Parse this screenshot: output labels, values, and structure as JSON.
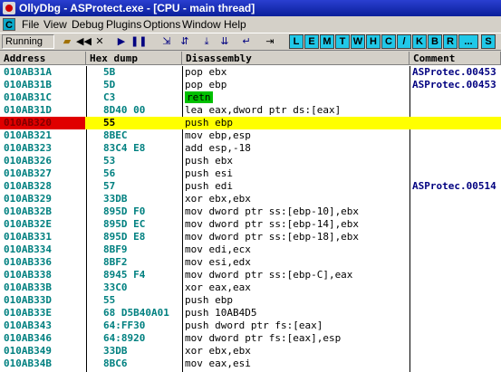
{
  "window": {
    "title": "OllyDbg - ASProtect.exe - [CPU - main thread]"
  },
  "menu": {
    "cpu_icon": "C",
    "items": [
      "File",
      "View",
      "Debug",
      "Plugins",
      "Options",
      "Window",
      "Help"
    ]
  },
  "toolbar": {
    "status": "Running",
    "buttons": [
      "open-icon",
      "rewind-icon",
      "close-icon",
      "run-icon",
      "pause-icon",
      "step-into-icon",
      "step-over-icon",
      "trace-into-icon",
      "trace-over-icon",
      "execute-till-return-icon",
      "goto-icon"
    ],
    "letters": [
      "L",
      "E",
      "M",
      "T",
      "W",
      "H",
      "C",
      "/",
      "K",
      "B",
      "R",
      "...",
      "S"
    ]
  },
  "columns": [
    "Address",
    "Hex dump",
    "Disassembly",
    "Comment"
  ],
  "rows": [
    {
      "addr": "010AB31A",
      "hex": "5B",
      "dis": "pop ebx",
      "comment": "ASProtec.00453"
    },
    {
      "addr": "010AB31B",
      "hex": "5D",
      "dis": "pop ebp",
      "comment": "ASProtec.00453"
    },
    {
      "addr": "010AB31C",
      "hex": "C3",
      "dis": "retn",
      "comment": "",
      "retn": true
    },
    {
      "addr": "010AB31D",
      "hex": "8D40 00",
      "dis": "lea eax,dword ptr ds:[eax]",
      "comment": ""
    },
    {
      "addr": "010AB320",
      "hex": "55",
      "dis": "push ebp",
      "comment": "",
      "highlight": true
    },
    {
      "addr": "010AB321",
      "hex": "8BEC",
      "dis": "mov ebp,esp",
      "comment": ""
    },
    {
      "addr": "010AB323",
      "hex": "83C4 E8",
      "dis": "add esp,-18",
      "comment": ""
    },
    {
      "addr": "010AB326",
      "hex": "53",
      "dis": "push ebx",
      "comment": ""
    },
    {
      "addr": "010AB327",
      "hex": "56",
      "dis": "push esi",
      "comment": ""
    },
    {
      "addr": "010AB328",
      "hex": "57",
      "dis": "push edi",
      "comment": "ASProtec.00514"
    },
    {
      "addr": "010AB329",
      "hex": "33DB",
      "dis": "xor ebx,ebx",
      "comment": ""
    },
    {
      "addr": "010AB32B",
      "hex": "895D F0",
      "dis": "mov dword ptr ss:[ebp-10],ebx",
      "comment": ""
    },
    {
      "addr": "010AB32E",
      "hex": "895D EC",
      "dis": "mov dword ptr ss:[ebp-14],ebx",
      "comment": ""
    },
    {
      "addr": "010AB331",
      "hex": "895D E8",
      "dis": "mov dword ptr ss:[ebp-18],ebx",
      "comment": ""
    },
    {
      "addr": "010AB334",
      "hex": "8BF9",
      "dis": "mov edi,ecx",
      "comment": ""
    },
    {
      "addr": "010AB336",
      "hex": "8BF2",
      "dis": "mov esi,edx",
      "comment": ""
    },
    {
      "addr": "010AB338",
      "hex": "8945 F4",
      "dis": "mov dword ptr ss:[ebp-C],eax",
      "comment": ""
    },
    {
      "addr": "010AB33B",
      "hex": "33C0",
      "dis": "xor eax,eax",
      "comment": ""
    },
    {
      "addr": "010AB33D",
      "hex": "55",
      "dis": "push ebp",
      "comment": ""
    },
    {
      "addr": "010AB33E",
      "hex": "68 D5B40A01",
      "dis": "push 10AB4D5",
      "comment": ""
    },
    {
      "addr": "010AB343",
      "hex": "64:FF30",
      "dis": "push dword ptr fs:[eax]",
      "comment": ""
    },
    {
      "addr": "010AB346",
      "hex": "64:8920",
      "dis": "mov dword ptr fs:[eax],esp",
      "comment": ""
    },
    {
      "addr": "010AB349",
      "hex": "33DB",
      "dis": "xor ebx,ebx",
      "comment": ""
    },
    {
      "addr": "010AB34B",
      "hex": "8BC6",
      "dis": "mov eax,esi",
      "comment": ""
    }
  ]
}
